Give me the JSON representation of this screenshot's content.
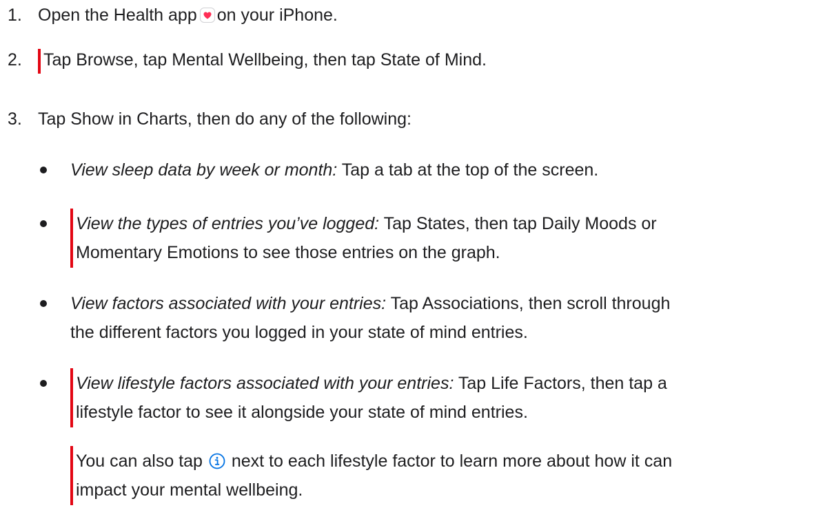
{
  "steps": [
    {
      "number": "1.",
      "text_before_icon": "Open the Health app",
      "icon": "health-app-heart-icon",
      "text_after_icon": "on your iPhone."
    },
    {
      "number": "2.",
      "text": "Tap Browse, tap Mental Wellbeing, then tap State of Mind."
    },
    {
      "number": "3.",
      "text": "Tap Show in Charts, then do any of the following:",
      "bullets": [
        {
          "label": "View sleep data by week or month:",
          "lines": [
            " Tap a tab at the top of the screen."
          ]
        },
        {
          "label": "View the types of entries you’ve logged:",
          "lines": [
            " Tap States, then tap Daily Moods or",
            "Momentary Emotions to see those entries on the graph."
          ]
        },
        {
          "label": "View factors associated with your entries:",
          "lines": [
            " Tap Associations, then scroll through",
            "the different factors you logged in your state of mind entries."
          ]
        },
        {
          "label": "View lifestyle factors associated with your entries:",
          "lines": [
            " Tap Life Factors, then tap a",
            "lifestyle factor to see it alongside your state of mind entries."
          ]
        }
      ],
      "note": {
        "text_before_icon": "You can also tap",
        "icon": "info-circle-icon",
        "text_after_icon": "next to each lifestyle factor to learn more about how it can",
        "line2": "impact your mental wellbeing."
      }
    }
  ],
  "colors": {
    "text": "#1d1d1f",
    "change_bar": "#e30613",
    "heart": "#ff2d55",
    "info_icon": "#0071e3"
  }
}
